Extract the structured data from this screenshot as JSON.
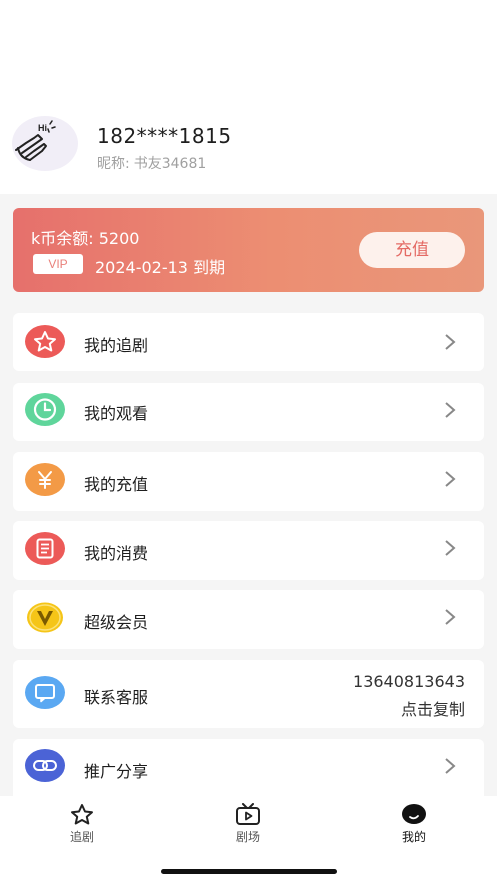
{
  "profile": {
    "phone": "182****1815",
    "nickname_label": "昵称:",
    "nickname": "书友34681",
    "avatar_icon": "waving-hand-hi-icon"
  },
  "vip_card": {
    "balance_text": "k币余额: 5200",
    "vip_badge": "VIP",
    "expire_text": "2024-02-13 到期",
    "recharge_label": "充值",
    "gradient_start": "#e6706c",
    "gradient_end": "#e9977a"
  },
  "menu": {
    "items": [
      {
        "label": "我的追剧",
        "icon": "star-icon",
        "color": "#ec5a58"
      },
      {
        "label": "我的观看",
        "icon": "clock-icon",
        "color": "#5fd59b"
      },
      {
        "label": "我的充值",
        "icon": "yen-icon",
        "color": "#f39a46"
      },
      {
        "label": "我的消费",
        "icon": "receipt-icon",
        "color": "#ec5a58"
      },
      {
        "label": "超级会员",
        "icon": "v-badge-icon",
        "color": "#f5c518"
      },
      {
        "label": "联系客服",
        "icon": "chat-icon",
        "color": "#5aa8f2"
      },
      {
        "label": "推广分享",
        "icon": "link-icon",
        "color": "#4b63d6"
      }
    ],
    "service_phone": "13640813643",
    "service_copy": "点击复制"
  },
  "tabbar": {
    "tabs": [
      {
        "label": "追剧",
        "icon": "star-outline-icon"
      },
      {
        "label": "剧场",
        "icon": "tv-play-icon"
      },
      {
        "label": "我的",
        "icon": "profile-smile-icon",
        "active": true
      }
    ]
  }
}
